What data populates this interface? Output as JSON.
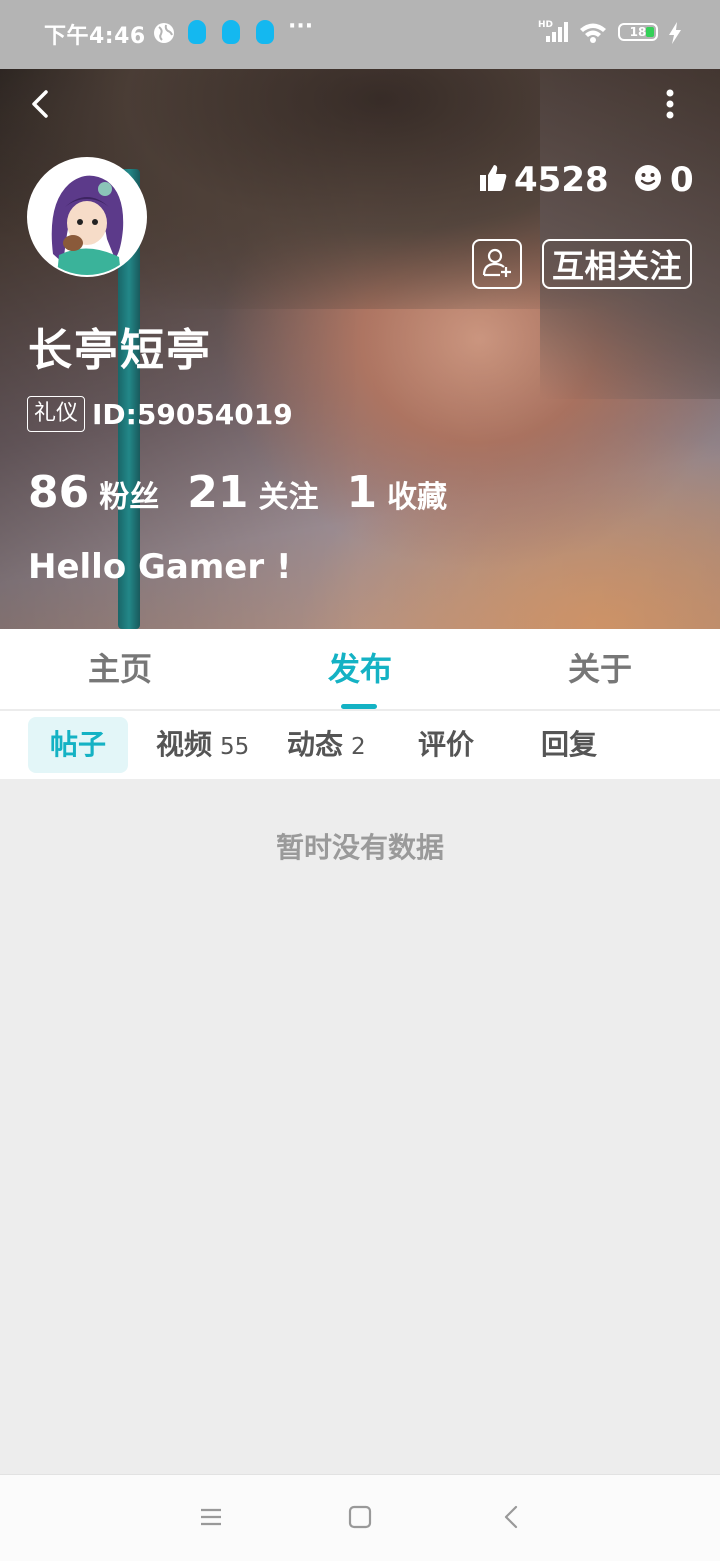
{
  "status_bar": {
    "time": "下午4:46",
    "battery": "18",
    "network": "HD",
    "more": "···"
  },
  "profile": {
    "username": "长亭短亭",
    "role_badge": "礼仪",
    "user_id": "ID:59054019",
    "likes": "4528",
    "emoji_count": "0",
    "mutual_follow_label": "互相关注",
    "bio": "Hello Gamer !",
    "stats": [
      {
        "value": "86",
        "label": "粉丝"
      },
      {
        "value": "21",
        "label": "关注"
      },
      {
        "value": "1",
        "label": "收藏"
      }
    ]
  },
  "tabs": [
    {
      "label": "主页"
    },
    {
      "label": "发布"
    },
    {
      "label": "关于"
    }
  ],
  "active_tab": "发布",
  "sub_tabs": [
    {
      "label": "帖子",
      "count": ""
    },
    {
      "label": "视频",
      "count": "55"
    },
    {
      "label": "动态",
      "count": "2"
    },
    {
      "label": "评价",
      "count": ""
    },
    {
      "label": "回复",
      "count": ""
    }
  ],
  "empty_message": "暂时没有数据",
  "colors": {
    "accent": "#14b2c4",
    "status_bar": "#b4b4b4",
    "qq": "#14b8f0"
  }
}
